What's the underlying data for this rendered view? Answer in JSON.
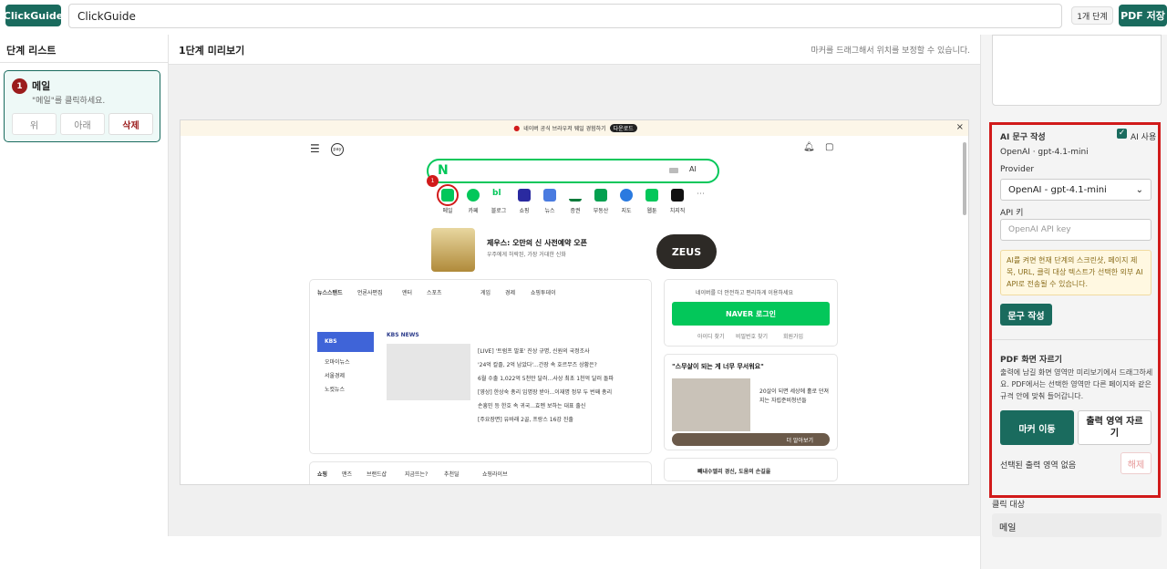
{
  "topbar": {
    "brand": "ClickGuide",
    "title_value": "ClickGuide",
    "step_count": "1개 단계",
    "pdf_save": "PDF 저장"
  },
  "left": {
    "heading": "단계 리스트",
    "steps": [
      {
        "number": "1",
        "name": "메일",
        "desc": "\"메일\"를 클릭하세요.",
        "up": "위",
        "down": "아래",
        "delete": "삭제"
      }
    ]
  },
  "center": {
    "heading": "1단계 미리보기",
    "hint": "마커를 드래그해서 위치를 보정할 수 있습니다."
  },
  "preview": {
    "banner": "네이버 공식 브라우저 웨일 경험하기",
    "banner_badge": "다운로드",
    "ai_label": "AI",
    "marker": "1",
    "services": [
      "메일",
      "카페",
      "블로그",
      "쇼핑",
      "뉴스",
      "증권",
      "부동산",
      "지도",
      "웹툰",
      "치지직"
    ],
    "promo_title": "제우스: 오만의 신 사전예약 오픈",
    "promo_sub": "우주에게 허락된, 가장 거대한 신화",
    "promo_logo": "ZEUS",
    "news_tabs": [
      "뉴스스탠드",
      "언론사편집",
      "엔터",
      "스포츠",
      "게임",
      "경제",
      "쇼핑투데이"
    ],
    "news_headlines": [
      "[LIVE] '트럼프 발표' 진상 규명, 신원의 국정조사",
      "'24억 칼졸, 2억 남았다'...간장 속 호르무즈 상황은?",
      "6월 수출 1,022억 5천만 달러...사상 최초 1천억 달러 돌파",
      "[영상] 한상숙 총리 임명장 받아...이재명 정부 두 번째 총리",
      "손흥민 등 한호 속 귀국...효멘 보하는 대표 출신",
      "[주요장면] 유바래 2골, 프랑스 16강 진출"
    ],
    "news_side": [
      "KBS",
      "오마이뉴스",
      "서울경제",
      "노컷뉴스"
    ],
    "kbs_name": "KBS NEWS",
    "login_text": "네이버를 더 안전하고 편리하게 이용하세요",
    "login_btn": "NAVER 로그인",
    "login_links": [
      "아이디 찾기",
      "비밀번호 찾기",
      "회원가입"
    ],
    "ad_title": "\"스무살이 되는 게 너무 무서워요\"",
    "ad_body": "20살이 되면 세상에 홀로 던져지는 자립준비청년들",
    "ad_more": "더 알아보기",
    "shop_tabs": [
      "쇼핑",
      "맨즈",
      "브랜드샵",
      "지금뜨는?",
      "추천딜",
      "쇼핑라이브"
    ],
    "bottom_text": "빼내수엘리 경신, 도움의 손길을"
  },
  "right": {
    "ai_title": "AI 문구 작성",
    "ai_use": "AI 사용",
    "model": "OpenAI · gpt-4.1-mini",
    "provider_label": "Provider",
    "provider_value": "OpenAI - gpt-4.1-mini",
    "api_label": "API 키",
    "api_placeholder": "OpenAI API key",
    "note": "AI를 켜면 현재 단계의 스크린샷, 페이지 제목, URL, 클릭 대상 텍스트가 선택한 외부 AI API로 전송될 수 있습니다.",
    "generate": "문구 작성",
    "crop_title": "PDF 화면 자르기",
    "crop_desc": "출력에 남길 화면 영역만 미리보기에서 드래그하세요. PDF에서는 선택한 영역만 다른 페이지와 같은 규격 안에 맞춰 들어갑니다.",
    "marker_move": "마커 이동",
    "set_area": "출력 영역 자르기",
    "no_area": "선택된 출력 영역 없음",
    "release": "해제",
    "target_head": "클릭 대상",
    "target_value": "메일"
  },
  "colors": {
    "accent": "#1a6b5e",
    "highlight": "#d11a1a",
    "naver": "#03c75a"
  }
}
